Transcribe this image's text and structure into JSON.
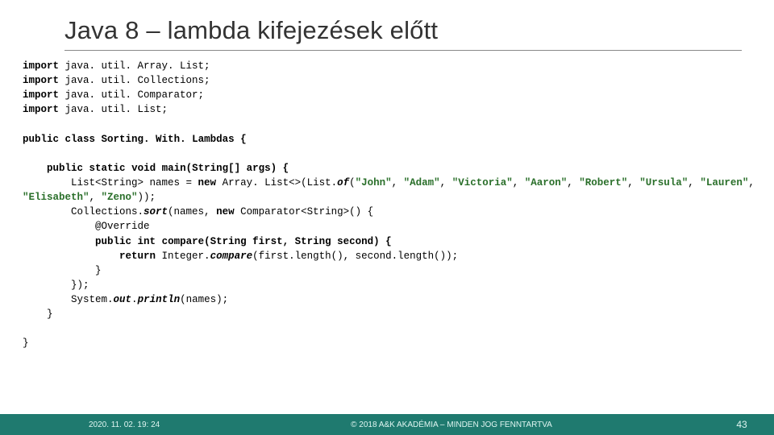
{
  "title": "Java 8 – lambda kifejezések előtt",
  "code": {
    "kw_import": "import",
    "imp1": " java. util. Array. List;",
    "imp2": " java. util. Collections;",
    "imp3": " java. util. Comparator;",
    "imp4": " java. util. List;",
    "kw_public": "public",
    "kw_class": "class",
    "cls": " Sorting. With. Lambdas {",
    "kw_static": "static",
    "kw_void": "void",
    "main_sig": "main(String[] args) {",
    "list_decl1": "List<String> names = ",
    "kw_new": "new",
    "list_decl2": " Array. List<>(List.",
    "of": "of",
    "lp": "(",
    "s1": "\"John\"",
    "c": ", ",
    "s2": "\"Adam\"",
    "s3": "\"Victoria\"",
    "s4": "\"Aaron\"",
    "s5": "\"Robert\"",
    "s6": "\"Ursula\"",
    "s7": "\"Lauren\"",
    "s8": "\"Elisabeth\"",
    "s9": "\"Zeno\"",
    "rp": "));",
    "sort1": "Collections.",
    "sort_m": "sort",
    "sort2": "(names, ",
    "sort3": " Comparator<String>() {",
    "override": "@Override",
    "kw_int": "int",
    "cmp_sig": "compare(String first, String second) {",
    "kw_return": "return",
    "ret1": " Integer.",
    "cmpm": "compare",
    "ret2": "(first.",
    "lenm": "length",
    "ret3": "(), second.",
    "ret4": "());",
    "brace_c": "}",
    "brace_c2": "});",
    "out1": "System.",
    "outm": "out",
    "out2": ".",
    "println": "println",
    "out3": "(names);"
  },
  "footer": {
    "date": "2020. 11. 02. 19: 24",
    "copy": "© 2018 A&K AKADÉMIA – MINDEN JOG FENNTARTVA",
    "page": "43"
  }
}
